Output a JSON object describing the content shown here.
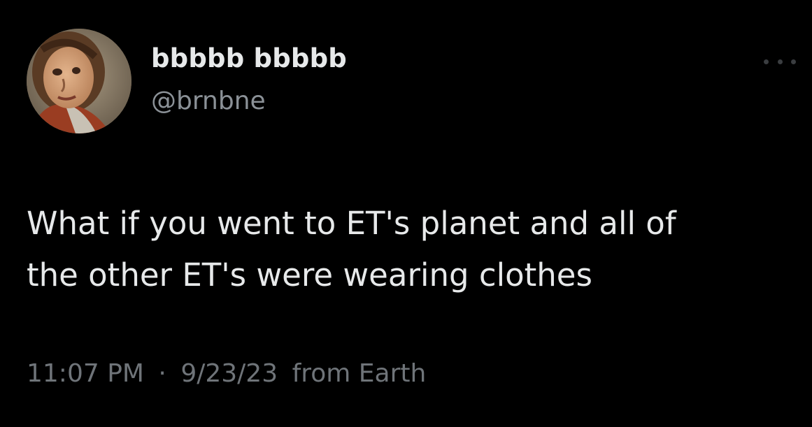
{
  "author": {
    "display_name": "bbbbb bbbbb",
    "handle": "@brnbne",
    "avatar": "avatar-portrait-image"
  },
  "tweet": {
    "text_lines": [
      "What if you went to ET's planet and all of",
      "the other ET's were wearing clothes"
    ]
  },
  "meta": {
    "time": "11:07 PM",
    "separator": "·",
    "date": "9/23/23",
    "source": "from Earth"
  },
  "icons": {
    "more": "more-options-icon"
  },
  "colors": {
    "background": "#000000",
    "primary_text": "#e7e9ea",
    "secondary_text": "#8b9197",
    "meta_text": "#6f7479"
  }
}
